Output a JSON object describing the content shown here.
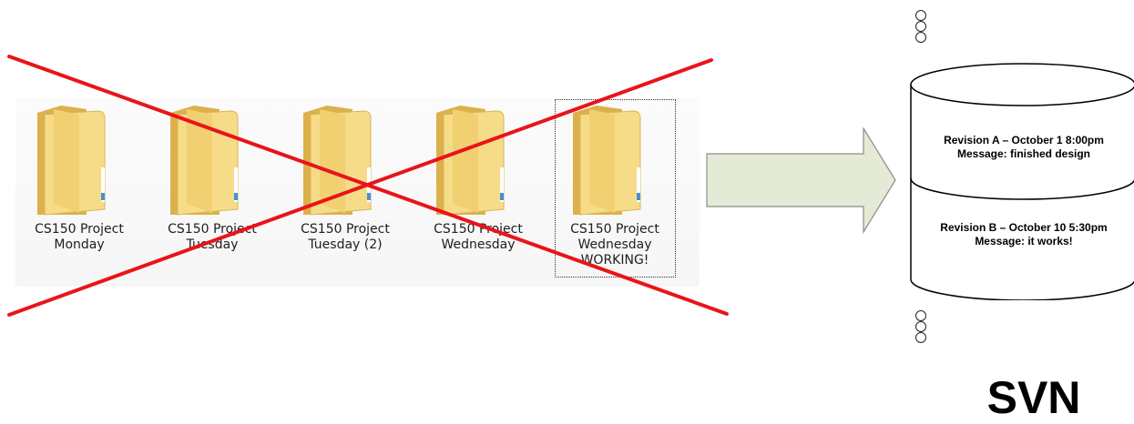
{
  "folders": [
    {
      "line1": "CS150 Project",
      "line2": "Monday",
      "line3": ""
    },
    {
      "line1": "CS150 Project",
      "line2": "Tuesday",
      "line3": ""
    },
    {
      "line1": "CS150 Project",
      "line2": "Tuesday (2)",
      "line3": ""
    },
    {
      "line1": "CS150 Project",
      "line2": "Wednesday",
      "line3": ""
    },
    {
      "line1": "CS150 Project",
      "line2": "Wednesday",
      "line3": "WORKING!"
    }
  ],
  "repository": {
    "revisions": [
      {
        "title": "Revision A – October 1 8:00pm",
        "message": "Message: finished design"
      },
      {
        "title": "Revision B – October 10 5:30pm",
        "message": "Message: it works!"
      }
    ],
    "label": "SVN"
  },
  "colors": {
    "cross": "#e8141a",
    "arrow_fill": "#e4ead6",
    "folder_front": "#f4d67a",
    "folder_back": "#e2b94e"
  }
}
